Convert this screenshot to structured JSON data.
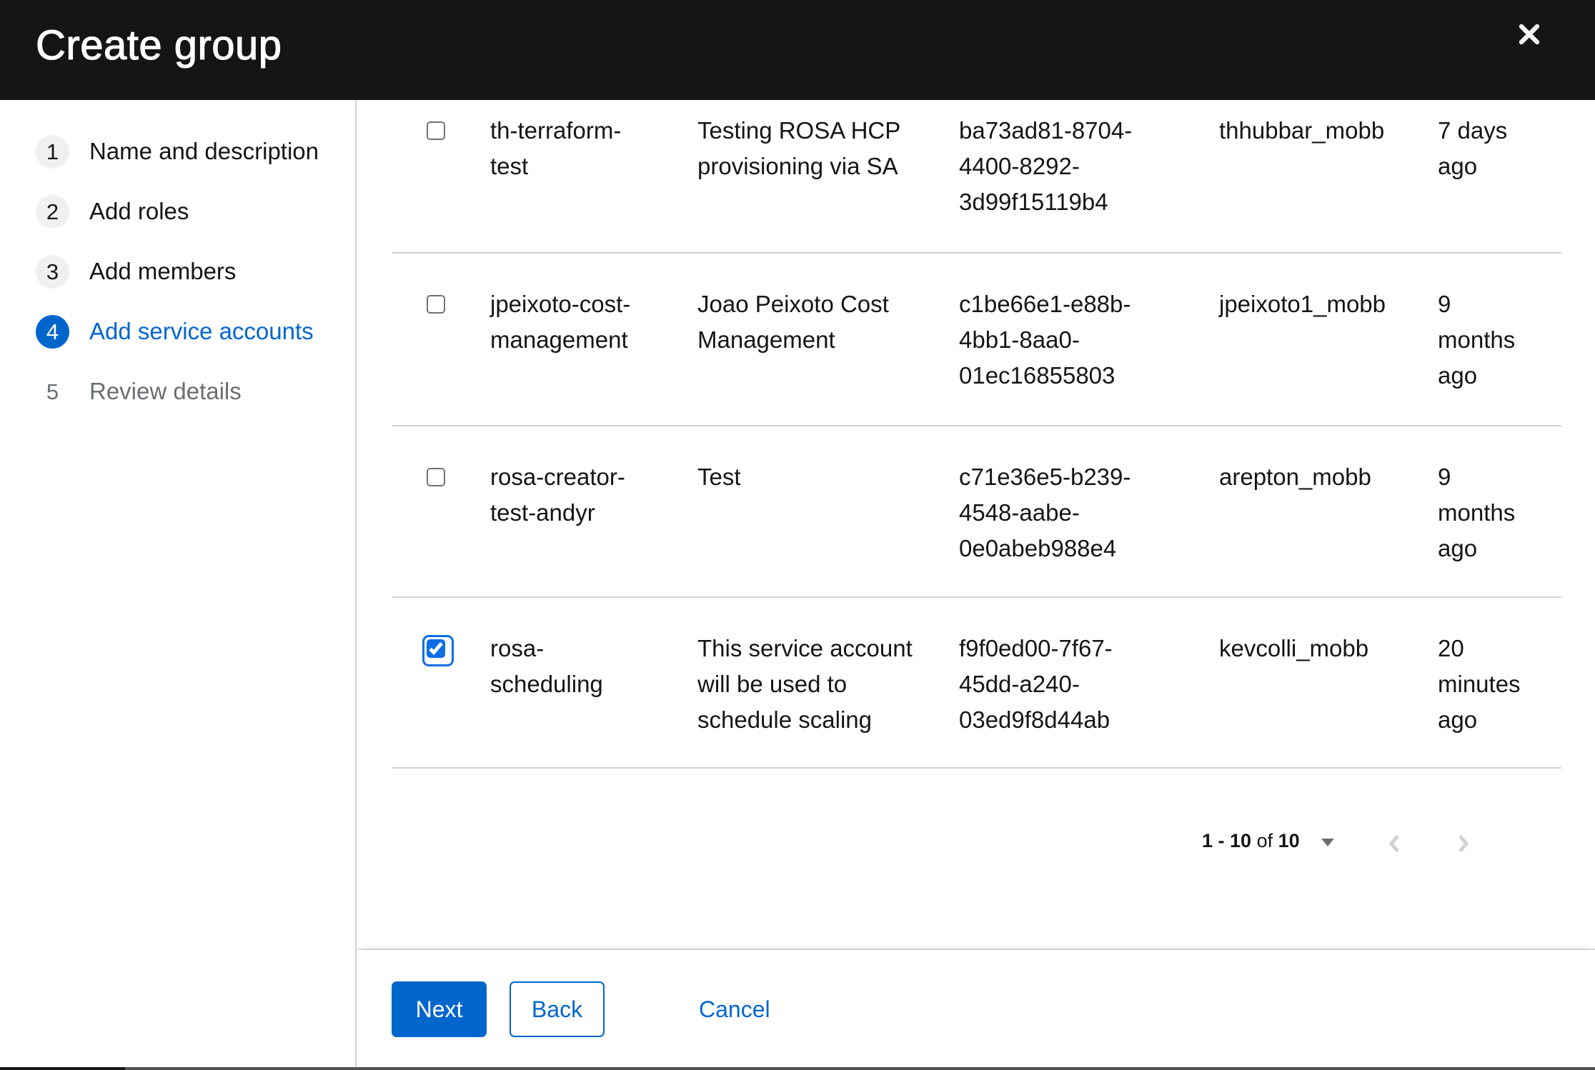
{
  "modal": {
    "title": "Create group"
  },
  "wizard": {
    "steps": [
      {
        "number": "1",
        "label": "Name and description",
        "state": "default"
      },
      {
        "number": "2",
        "label": "Add roles",
        "state": "default"
      },
      {
        "number": "3",
        "label": "Add members",
        "state": "default"
      },
      {
        "number": "4",
        "label": "Add service accounts",
        "state": "current"
      },
      {
        "number": "5",
        "label": "Review details",
        "state": "disabled"
      }
    ]
  },
  "table": {
    "rows": [
      {
        "selected": false,
        "name": "th-terraform-test",
        "description": "Testing ROSA HCP provisioning via SA",
        "client_id": "ba73ad81-8704-4400-8292-3d99f15119b4",
        "owner": "thhubbar_mobb",
        "time_created": "7 days ago"
      },
      {
        "selected": false,
        "name": "jpeixoto-cost-management",
        "description": "Joao Peixoto Cost Management",
        "client_id": "c1be66e1-e88b-4bb1-8aa0-01ec16855803",
        "owner": "jpeixoto1_mobb",
        "time_created": "9 months ago"
      },
      {
        "selected": false,
        "name": "rosa-creator-test-andyr",
        "description": "Test",
        "client_id": "c71e36e5-b239-4548-aabe-0e0abeb988e4",
        "owner": "arepton_mobb",
        "time_created": "9 months ago"
      },
      {
        "selected": true,
        "name": "rosa-scheduling",
        "description": "This service account will be used to schedule scaling",
        "client_id": "f9f0ed00-7f67-45dd-a240-03ed9f8d44ab",
        "owner": "kevcolli_mobb",
        "time_created": "20 minutes ago"
      }
    ]
  },
  "pagination": {
    "range": "1 - 10",
    "of_word": "of",
    "total": "10"
  },
  "footer": {
    "next_label": "Next",
    "back_label": "Back",
    "cancel_label": "Cancel"
  },
  "colors": {
    "primary": "#0066cc",
    "header_bg": "#151515",
    "divider": "#d2d2d2",
    "text": "#151515",
    "muted_text": "#6a6e73",
    "checkbox_checked": "#0e6ee6"
  }
}
